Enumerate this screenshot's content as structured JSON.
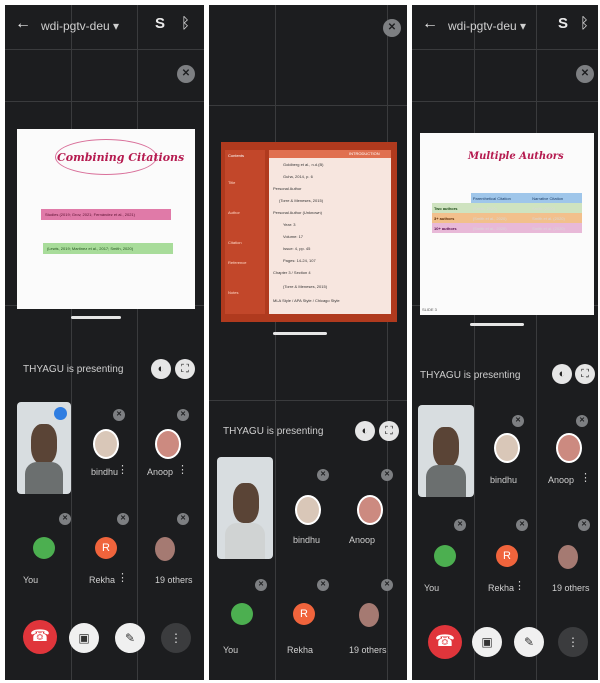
{
  "screens": [
    {
      "meeting_code": "wdi-pgtv-deu",
      "slide": {
        "title": "Combining Citations",
        "bar1": "Studies (2019; Grov, 2021; Fernández et al., 2021)",
        "bar2": "(Lewis, 2019; Martinez et al., 2017; Smith, 2020)"
      },
      "presenting": "THYAGU is presenting",
      "participants": [
        {
          "name": "bindhu",
          "initial": ""
        },
        {
          "name": "Anoop",
          "initial": ""
        },
        {
          "name": "You",
          "initial": ""
        },
        {
          "name": "Rekha",
          "initial": "R"
        },
        {
          "name": "19 others",
          "initial": ""
        }
      ]
    },
    {
      "slide": {
        "header_left": "Contents",
        "header_right": "INTRODUCTION",
        "lines": [
          "Goldberg et al., n.d.(B)",
          "Guha, 2014, p. 6",
          "Personal Author",
          "(Torre & Meneses, 2015)",
          "Personal Author (Unknown)",
          "Year: 3",
          "Volume: 17",
          "Issue: 4, pp. 45",
          "Pages: 14-24, 107",
          "Chapter 3 / Section 4",
          "(Torre & Meneses, 2015)",
          "MLA Style / APA Style / Chicago Style"
        ],
        "side_items": [
          "Title",
          "Author",
          "Citation",
          "Reference",
          "Notes"
        ]
      },
      "presenting": "THYAGU is presenting",
      "participants": [
        {
          "name": "bindhu",
          "initial": ""
        },
        {
          "name": "Anoop",
          "initial": ""
        },
        {
          "name": "You",
          "initial": ""
        },
        {
          "name": "Rekha",
          "initial": "R"
        },
        {
          "name": "19 others",
          "initial": ""
        }
      ]
    },
    {
      "meeting_code": "wdi-pgtv-deu",
      "slide": {
        "title": "Multiple Authors",
        "col_headers": [
          "",
          "Parenthetical Citation",
          "Narrative Citation"
        ],
        "rows": [
          [
            "Two authors",
            "(Smith, 2020)",
            "Smith (2020)"
          ],
          [
            "3+ authors",
            "(Smith et al., 2020)",
            "Smith et al. (2020)"
          ],
          [
            "10+ authors",
            "(Smith et al., 2020)",
            "Smith et al. (2020)"
          ]
        ],
        "footer": "SLIDE 3"
      },
      "presenting": "THYAGU is presenting",
      "participants": [
        {
          "name": "bindhu",
          "initial": ""
        },
        {
          "name": "Anoop",
          "initial": ""
        },
        {
          "name": "You",
          "initial": ""
        },
        {
          "name": "Rekha",
          "initial": "R"
        },
        {
          "name": "19 others",
          "initial": ""
        }
      ]
    }
  ],
  "icons": {
    "back": "←",
    "caret": "▾",
    "switch_camera": "S",
    "bluetooth": "ᛒ",
    "mic_off": "✕",
    "pin": "◐",
    "fullscreen": "⛶",
    "end_call": "☎",
    "cam_off": "▣",
    "mic": "✎",
    "more": "⋮"
  },
  "colors": {
    "end_call": "#e0353b",
    "rekha_avatar": "#f0643c",
    "you_avatar": "#4caf50",
    "accent_blue": "#2f7de1"
  }
}
